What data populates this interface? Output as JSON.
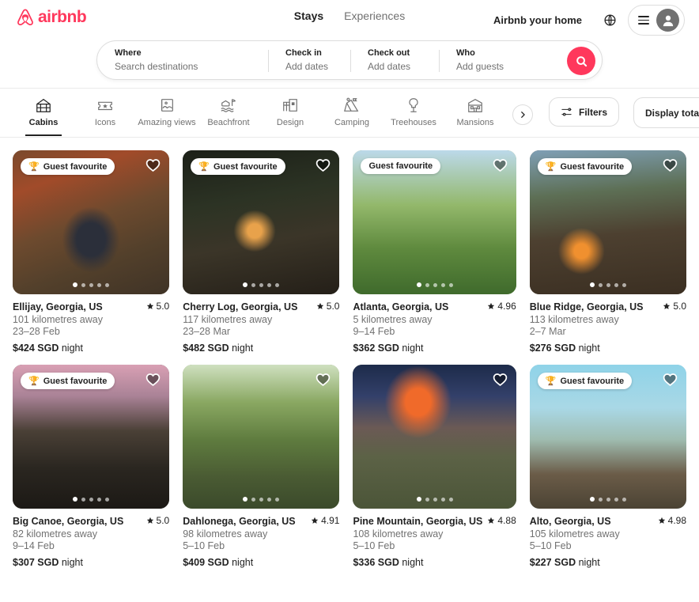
{
  "header": {
    "brand": "airbnb",
    "nav": [
      {
        "label": "Stays",
        "active": true
      },
      {
        "label": "Experiences",
        "active": false
      }
    ],
    "host_link": "Airbnb your home",
    "globe_icon": "globe-icon",
    "menu_icon": "hamburger-icon",
    "avatar_icon": "user-avatar-icon",
    "brand_color": "#FF385C"
  },
  "search": {
    "where_label": "Where",
    "where_placeholder": "Search destinations",
    "checkin_label": "Check in",
    "checkin_value": "Add dates",
    "checkout_label": "Check out",
    "checkout_value": "Add dates",
    "who_label": "Who",
    "who_value": "Add guests",
    "search_icon": "search-icon"
  },
  "categories": [
    {
      "label": "Cabins",
      "icon": "cabin-icon",
      "active": true
    },
    {
      "label": "Icons",
      "icon": "ticket-star-icon",
      "active": false
    },
    {
      "label": "Amazing views",
      "icon": "amazing-views-icon",
      "active": false
    },
    {
      "label": "Beachfront",
      "icon": "beachfront-icon",
      "active": false
    },
    {
      "label": "Design",
      "icon": "design-icon",
      "active": false
    },
    {
      "label": "Camping",
      "icon": "camping-icon",
      "active": false
    },
    {
      "label": "Treehouses",
      "icon": "treehouse-icon",
      "active": false
    },
    {
      "label": "Mansions",
      "icon": "mansion-icon",
      "active": false
    }
  ],
  "controls": {
    "scroll_next_icon": "chevron-right-icon",
    "filters_label": "Filters",
    "filters_icon": "filters-icon",
    "taxes_label": "Display total before taxes",
    "taxes_toggle_on": false
  },
  "badge_text": "Guest favourite",
  "trophy_icon": "trophy-icon",
  "heart_icon": "heart-icon",
  "star_icon": "star-icon",
  "listings": [
    {
      "title": "Ellijay, Georgia, US",
      "rating": "5.0",
      "distance": "101 kilometres away",
      "dates": "23–28 Feb",
      "price_amount": "$424 SGD",
      "price_unit": "night",
      "badge": true,
      "trophy": true,
      "dots": 5,
      "active_dot": 0,
      "photo_class": "p1"
    },
    {
      "title": "Cherry Log, Georgia, US",
      "rating": "5.0",
      "distance": "117 kilometres away",
      "dates": "23–28 Mar",
      "price_amount": "$482 SGD",
      "price_unit": "night",
      "badge": true,
      "trophy": true,
      "dots": 5,
      "active_dot": 0,
      "photo_class": "p2"
    },
    {
      "title": "Atlanta, Georgia, US",
      "rating": "4.96",
      "distance": "5 kilometres away",
      "dates": "9–14 Feb",
      "price_amount": "$362 SGD",
      "price_unit": "night",
      "badge": true,
      "trophy": false,
      "dots": 5,
      "active_dot": 0,
      "photo_class": "p3"
    },
    {
      "title": "Blue Ridge, Georgia, US",
      "rating": "5.0",
      "distance": "113 kilometres away",
      "dates": "2–7 Mar",
      "price_amount": "$276 SGD",
      "price_unit": "night",
      "badge": true,
      "trophy": true,
      "dots": 5,
      "active_dot": 0,
      "photo_class": "p4"
    },
    {
      "title": "Big Canoe, Georgia, US",
      "rating": "5.0",
      "distance": "82 kilometres away",
      "dates": "9–14 Feb",
      "price_amount": "$307 SGD",
      "price_unit": "night",
      "badge": true,
      "trophy": true,
      "dots": 5,
      "active_dot": 0,
      "photo_class": "p5"
    },
    {
      "title": "Dahlonega, Georgia, US",
      "rating": "4.91",
      "distance": "98 kilometres away",
      "dates": "5–10 Feb",
      "price_amount": "$409 SGD",
      "price_unit": "night",
      "badge": false,
      "trophy": false,
      "dots": 5,
      "active_dot": 0,
      "photo_class": "p6"
    },
    {
      "title": "Pine Mountain, Georgia, US",
      "rating": "4.88",
      "distance": "108 kilometres away",
      "dates": "5–10 Feb",
      "price_amount": "$336 SGD",
      "price_unit": "night",
      "badge": false,
      "trophy": false,
      "dots": 5,
      "active_dot": 0,
      "photo_class": "p7"
    },
    {
      "title": "Alto, Georgia, US",
      "rating": "4.98",
      "distance": "105 kilometres away",
      "dates": "5–10 Feb",
      "price_amount": "$227 SGD",
      "price_unit": "night",
      "badge": true,
      "trophy": true,
      "dots": 5,
      "active_dot": 0,
      "photo_class": "p8"
    }
  ]
}
